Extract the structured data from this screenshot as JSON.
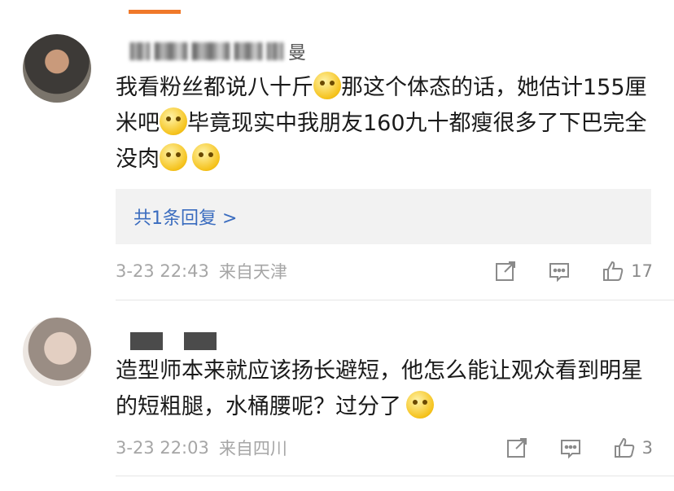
{
  "comments": [
    {
      "username_suffix": "曼",
      "text_before_1": "我看粉丝都说八十斤",
      "text_mid_1": "那这个体态的话，她估计155厘米吧",
      "text_mid_2": "毕竟现实中我朋友160九十都瘦很多了下巴完全没肉",
      "reply_link": "共1条回复 >",
      "time": "3-23 22:43",
      "location": "来自天津",
      "likes": "17"
    },
    {
      "username_suffix": "",
      "text_1": "造型师本来就应该扬长避短，他怎么能让观众看到明星的短粗腿，水桶腰呢？过分了",
      "time": "3-23 22:03",
      "location": "来自四川",
      "likes": "3"
    }
  ],
  "icons": {
    "share": "share-icon",
    "comment": "comment-icon",
    "like": "thumbs-up-icon",
    "emoji_laugh": "laugh-cry-emoji",
    "emoji_smile": "awkward-smile-emoji",
    "emoji_cry": "crying-emoji"
  },
  "colors": {
    "link": "#3a6cbf",
    "meta": "#a6a6a6",
    "highlight_bar": "#f0792a"
  }
}
